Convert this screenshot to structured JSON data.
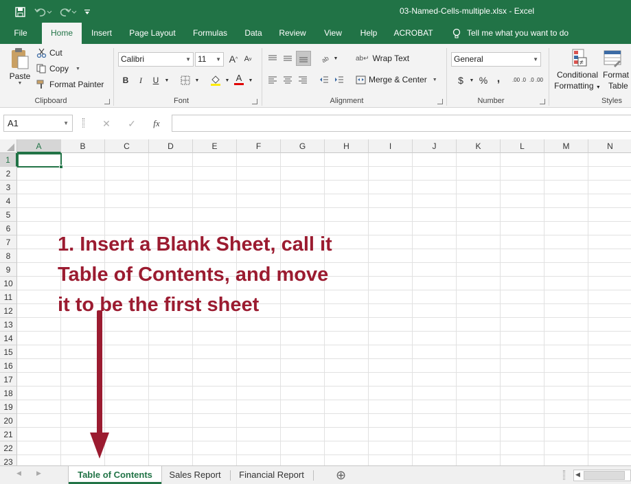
{
  "titlebar": {
    "title": "03-Named-Cells-multiple.xlsx  -  Excel",
    "qa_save_icon": "save-icon",
    "qa_undo_icon": "undo-icon",
    "qa_redo_icon": "redo-icon"
  },
  "tabs": [
    "File",
    "Home",
    "Insert",
    "Page Layout",
    "Formulas",
    "Data",
    "Review",
    "View",
    "Help",
    "ACROBAT"
  ],
  "active_tab": "Home",
  "tell_me": "Tell me what you want to do",
  "ribbon": {
    "clipboard": {
      "paste": "Paste",
      "cut": "Cut",
      "copy": "Copy",
      "format_painter": "Format Painter",
      "label": "Clipboard"
    },
    "font": {
      "name": "Calibri",
      "size": "11",
      "label": "Font",
      "bold": "B",
      "italic": "I",
      "underline": "U"
    },
    "alignment": {
      "wrap_text": "Wrap Text",
      "merge_center": "Merge & Center",
      "label": "Alignment"
    },
    "number": {
      "format": "General",
      "currency": "$",
      "percent": "%",
      "comma": ",",
      "label": "Number",
      "inc_dec": ".00 .0",
      "dec_dec": ".0 .00"
    },
    "styles": {
      "conditional": "Conditional",
      "formatting": "Formatting",
      "format_table_1": "Format",
      "format_table_2": "Table",
      "label": "Styles"
    }
  },
  "formula_bar": {
    "name_box": "A1",
    "cancel": "✕",
    "enter": "✓",
    "fx": "fx",
    "value": ""
  },
  "columns": [
    "A",
    "B",
    "C",
    "D",
    "E",
    "F",
    "G",
    "H",
    "I",
    "J",
    "K",
    "L",
    "M",
    "N"
  ],
  "rows": [
    "1",
    "2",
    "3",
    "4",
    "5",
    "6",
    "7",
    "8",
    "9",
    "10",
    "11",
    "12",
    "13",
    "14",
    "15",
    "16",
    "17",
    "18",
    "19",
    "20",
    "21",
    "22",
    "23"
  ],
  "selected_cell": "A1",
  "annotation": "1. Insert a Blank Sheet, call it\nTable of Contents, and move\nit to be the first sheet",
  "annotation_color": "#9b1b30",
  "accent_color": "#217346",
  "sheets": [
    {
      "name": "Table of Contents",
      "active": true
    },
    {
      "name": "Sales Report",
      "active": false
    },
    {
      "name": "Financial Report",
      "active": false
    }
  ],
  "add_sheet": "⊕"
}
